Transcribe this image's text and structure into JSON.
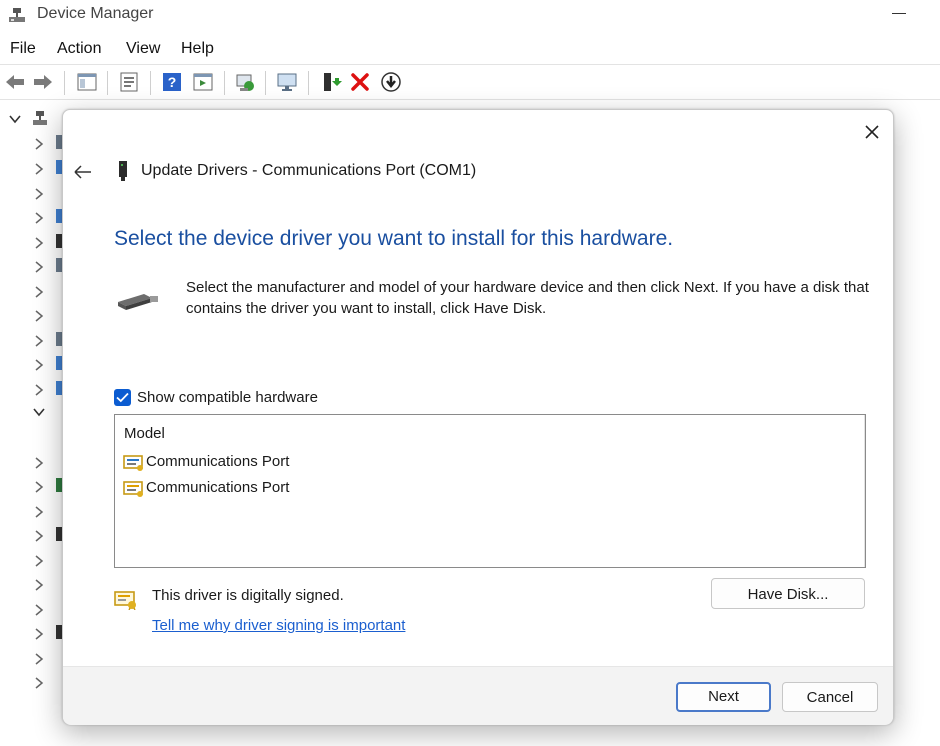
{
  "app": {
    "title": "Device Manager"
  },
  "menu": [
    "File",
    "Action",
    "View",
    "Help"
  ],
  "dialog": {
    "title": "Update Drivers - Communications Port (COM1)",
    "heading": "Select the device driver you want to install for this hardware.",
    "instruction": "Select the manufacturer and model of your hardware device and then click Next. If you have a disk that contains the driver you want to install, click Have Disk.",
    "show_compatible": {
      "label": "Show compatible hardware",
      "checked": true
    },
    "model_list": {
      "header": "Model",
      "items": [
        {
          "label": "Communications Port",
          "selected": true
        },
        {
          "label": "Communications Port",
          "selected": false
        }
      ]
    },
    "signed_text": "This driver is digitally signed.",
    "signing_link": "Tell me why driver signing is important",
    "have_disk": "Have Disk...",
    "next": "Next",
    "cancel": "Cancel"
  },
  "colors": {
    "heading": "#1a4fa0",
    "link": "#1b5fcf",
    "accent": "#0b5cd1"
  }
}
